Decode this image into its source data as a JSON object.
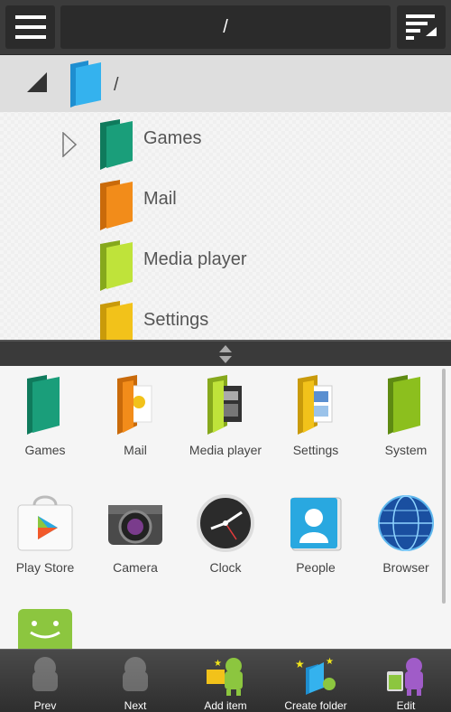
{
  "toolbar": {
    "path": "/",
    "menu_icon": "menu-icon",
    "sort_icon": "sort-icon"
  },
  "tree": {
    "root_label": "/",
    "items": [
      {
        "label": "Games",
        "color": "#1a9e7a"
      },
      {
        "label": "Mail",
        "color": "#f28c1a"
      },
      {
        "label": "Media player",
        "color": "#a8cf2a"
      },
      {
        "label": "Settings",
        "color": "#f2c21a"
      }
    ]
  },
  "grid": {
    "row1": [
      "Games",
      "Mail",
      "Media player",
      "Settings",
      "System"
    ],
    "row2": [
      "Play Store",
      "Camera",
      "Clock",
      "People",
      "Browser"
    ]
  },
  "bottom": {
    "prev": "Prev",
    "next": "Next",
    "add_item": "Add item",
    "create_folder": "Create folder",
    "edit": "Edit"
  },
  "colors": {
    "accent_blue": "#29a8e0",
    "toolbar": "#3b3b3b"
  }
}
